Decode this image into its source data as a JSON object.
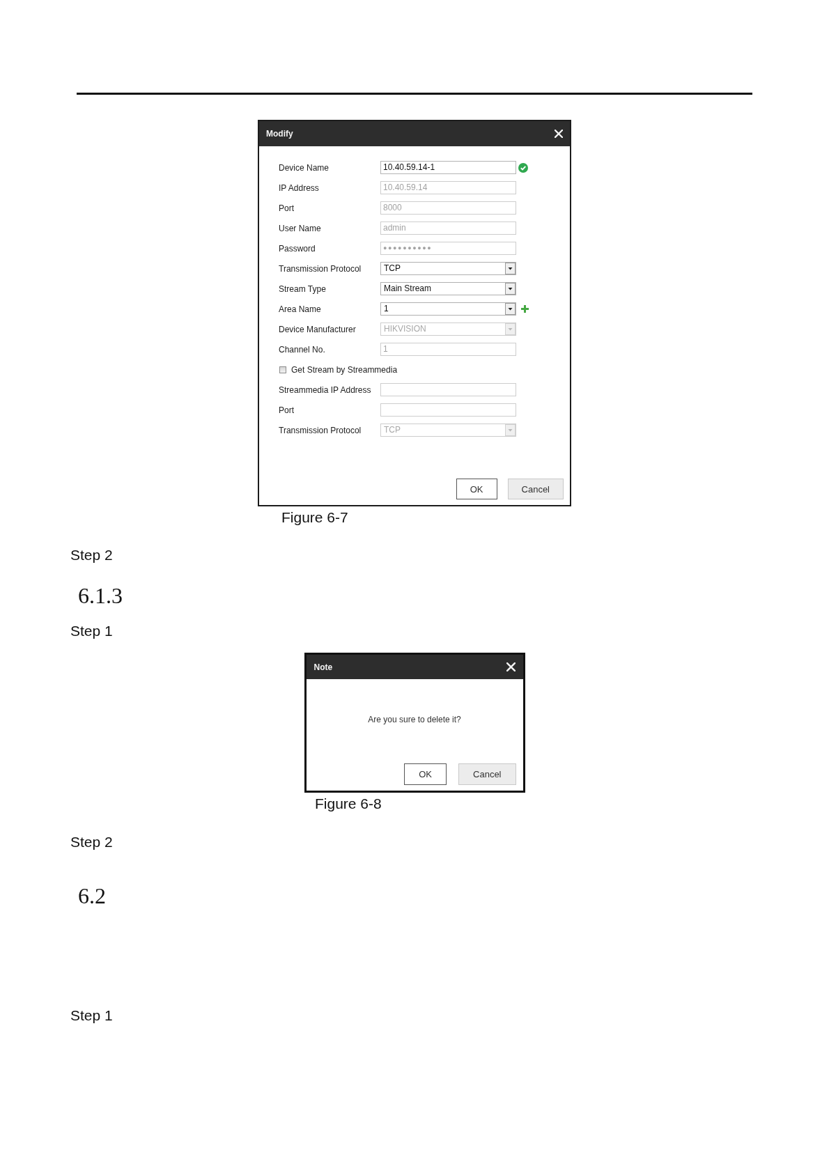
{
  "blocks": [
    {
      "kind": "figure",
      "dialog": {
        "kind": "form",
        "title": "Modify",
        "fields": [
          {
            "kind": "text",
            "label": "Device Name",
            "value": "10.40.59.14-1",
            "disabled": false,
            "validated": true,
            "add_button": false
          },
          {
            "kind": "text",
            "label": "IP Address",
            "value": "10.40.59.14",
            "disabled": true,
            "validated": false,
            "add_button": false
          },
          {
            "kind": "text",
            "label": "Port",
            "value": "8000",
            "disabled": true,
            "validated": false,
            "add_button": false
          },
          {
            "kind": "text",
            "label": "User Name",
            "value": "admin",
            "disabled": true,
            "validated": false,
            "add_button": false
          },
          {
            "kind": "password",
            "label": "Password",
            "value": "●●●●●●●●●●",
            "disabled": true,
            "validated": false,
            "add_button": false
          },
          {
            "kind": "select",
            "label": "Transmission Protocol",
            "value": "TCP",
            "disabled": false,
            "validated": false,
            "add_button": false
          },
          {
            "kind": "select",
            "label": "Stream Type",
            "value": "Main Stream",
            "disabled": false,
            "validated": false,
            "add_button": false
          },
          {
            "kind": "select",
            "label": "Area Name",
            "value": "1",
            "disabled": false,
            "validated": false,
            "add_button": true
          },
          {
            "kind": "select",
            "label": "Device Manufacturer",
            "value": "HIKVISION",
            "disabled": true,
            "validated": false,
            "add_button": false
          },
          {
            "kind": "text",
            "label": "Channel No.",
            "value": "1",
            "disabled": true,
            "validated": false,
            "add_button": false
          },
          {
            "kind": "checkbox",
            "label": "Get Stream by Streammedia",
            "checked": false
          },
          {
            "kind": "text",
            "label": "Streammedia IP Address",
            "disabled": true,
            "validated": false,
            "add_button": false
          },
          {
            "kind": "text",
            "label": "Port",
            "disabled": true,
            "validated": false,
            "add_button": false
          },
          {
            "kind": "select",
            "label": "Transmission Protocol",
            "value": "TCP",
            "disabled": true,
            "validated": false,
            "add_button": false
          }
        ],
        "buttons": [
          {
            "label": "OK",
            "primary": true
          },
          {
            "label": "Cancel",
            "primary": false
          }
        ]
      },
      "caption": "Figure 6-7"
    },
    {
      "kind": "step",
      "text": "Step 2"
    },
    {
      "kind": "heading",
      "text": "6.1.3"
    },
    {
      "kind": "step",
      "text": "Step 1"
    },
    {
      "kind": "figure",
      "dialog": {
        "kind": "message",
        "title": "Note",
        "message": "Are you sure to delete it?",
        "buttons": [
          {
            "label": "OK",
            "primary": true
          },
          {
            "label": "Cancel",
            "primary": false
          }
        ]
      },
      "caption": "Figure 6-8"
    },
    {
      "kind": "step",
      "text": "Step 2"
    },
    {
      "kind": "heading",
      "text": "6.2"
    },
    {
      "kind": "step",
      "text": "Step 1"
    }
  ]
}
